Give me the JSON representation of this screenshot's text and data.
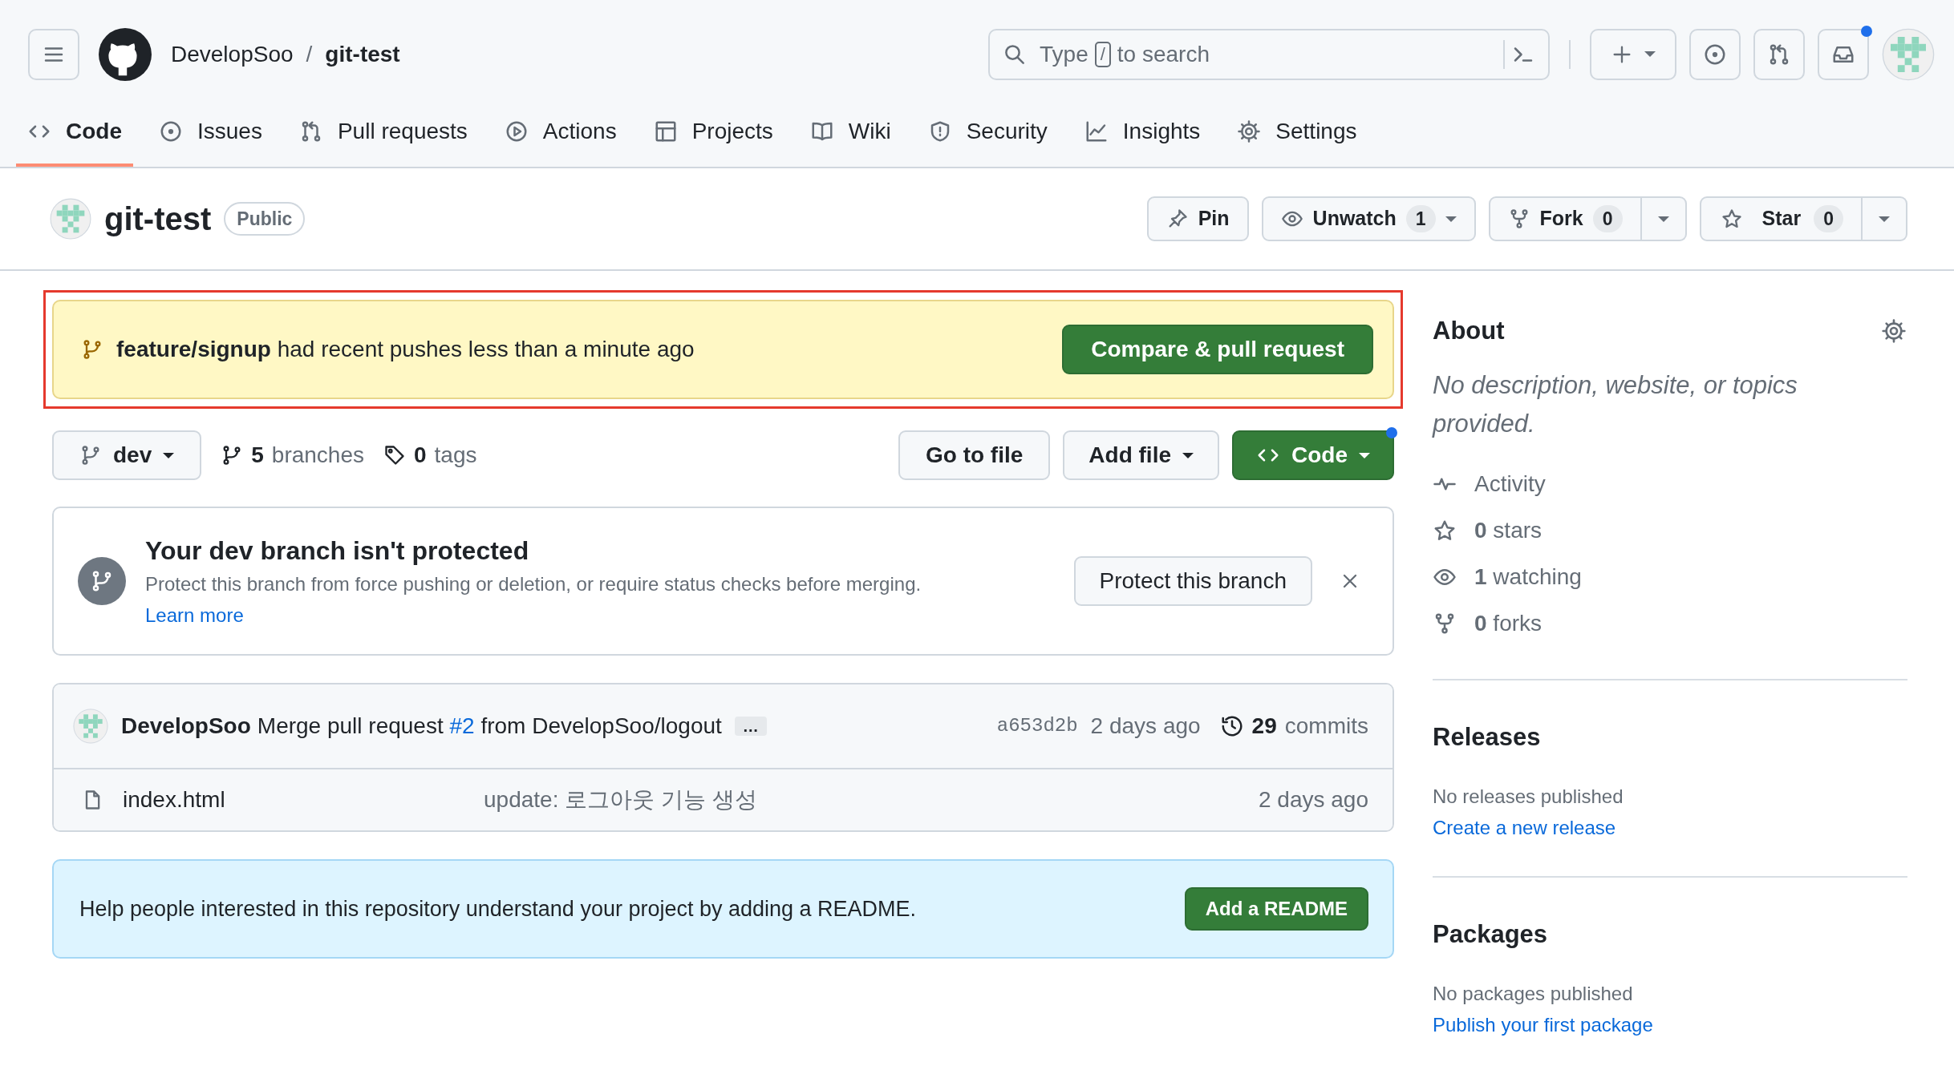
{
  "header": {
    "owner": "DevelopSoo",
    "separator": "/",
    "repo": "git-test",
    "search": {
      "before": "Type",
      "key": "/",
      "after": "to search"
    },
    "notifications": {
      "unread": true
    }
  },
  "tabs": [
    {
      "label": "Code",
      "selected": true
    },
    {
      "label": "Issues",
      "selected": false
    },
    {
      "label": "Pull requests",
      "selected": false
    },
    {
      "label": "Actions",
      "selected": false
    },
    {
      "label": "Projects",
      "selected": false
    },
    {
      "label": "Wiki",
      "selected": false
    },
    {
      "label": "Security",
      "selected": false
    },
    {
      "label": "Insights",
      "selected": false
    },
    {
      "label": "Settings",
      "selected": false
    }
  ],
  "repo_header": {
    "name": "git-test",
    "visibility": "Public",
    "pin": "Pin",
    "watch": {
      "label": "Unwatch",
      "count": "1"
    },
    "fork": {
      "label": "Fork",
      "count": "0"
    },
    "star": {
      "label": "Star",
      "count": "0"
    }
  },
  "push_banner": {
    "branch": "feature/signup",
    "text": "had recent pushes less than a minute ago",
    "button": "Compare & pull request",
    "highlighted": true
  },
  "branch_bar": {
    "branch": "dev",
    "branches": {
      "count": "5",
      "label": "branches"
    },
    "tags": {
      "count": "0",
      "label": "tags"
    },
    "go_to_file": "Go to file",
    "add_file": "Add file",
    "code_button": {
      "label": "Code",
      "notice": true
    }
  },
  "protect_notice": {
    "title": "Your dev branch isn't protected",
    "text": "Protect this branch from force pushing or deletion, or require status checks before merging.",
    "link": "Learn more",
    "button": "Protect this branch"
  },
  "commit": {
    "author": "DevelopSoo",
    "message_before": "Merge pull request",
    "pr_link": "#2",
    "message_after": "from DevelopSoo/logout",
    "more": "…",
    "hash": "a653d2b",
    "time": "2 days ago",
    "commits_count": "29",
    "commits_label": "commits"
  },
  "files": [
    {
      "name": "index.html",
      "message": "update: 로그아웃 기능 생성",
      "time": "2 days ago"
    }
  ],
  "readme_banner": {
    "text": "Help people interested in this repository understand your project by adding a README.",
    "button": "Add a README"
  },
  "sidebar": {
    "about": {
      "title": "About",
      "description": "No description, website, or topics provided.",
      "stats": [
        {
          "label": "Activity"
        },
        {
          "count": "0",
          "label": "stars"
        },
        {
          "count": "1",
          "label": "watching"
        },
        {
          "count": "0",
          "label": "forks"
        }
      ]
    },
    "releases": {
      "title": "Releases",
      "text": "No releases published",
      "link": "Create a new release"
    },
    "packages": {
      "title": "Packages",
      "text": "No packages published",
      "link": "Publish your first package"
    }
  }
}
